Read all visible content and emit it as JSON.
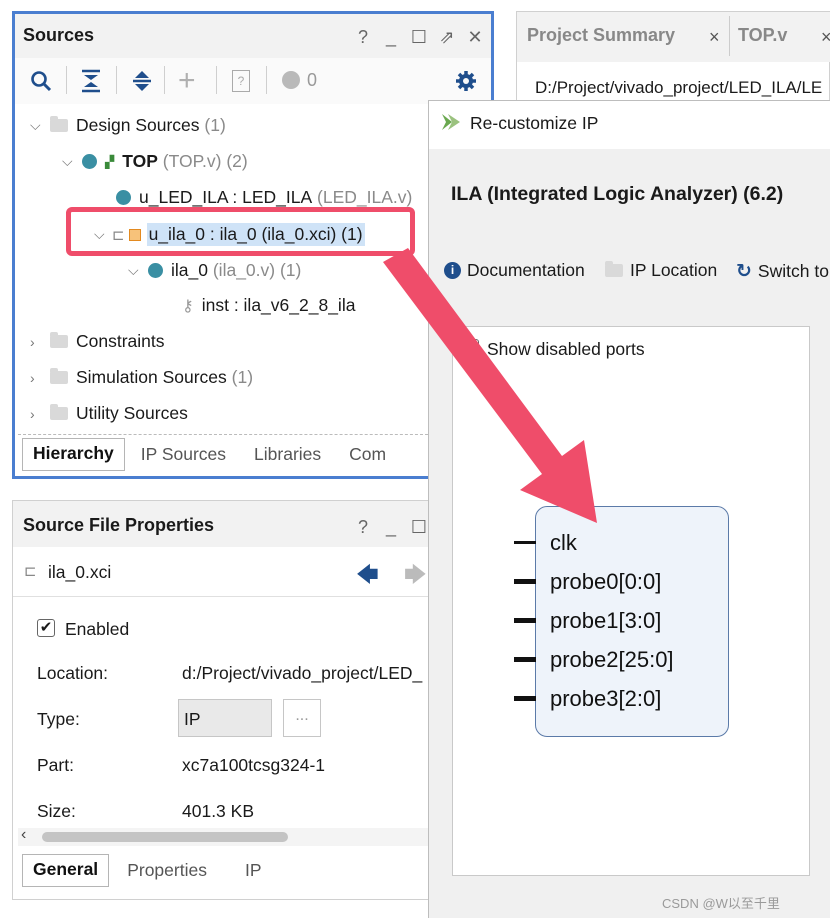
{
  "sources_panel": {
    "title": "Sources",
    "win_controls": [
      "?",
      "_",
      "☐",
      "⇗",
      "✕"
    ],
    "toolbar": {
      "counter": "0"
    },
    "tree": [
      {
        "label": "Design Sources",
        "suffix": "(1)"
      },
      {
        "label": "TOP",
        "suffix": "(TOP.v) (2)"
      },
      {
        "label": "u_LED_ILA : LED_ILA",
        "suffix": "(LED_ILA.v)"
      },
      {
        "label": "u_ila_0 : ila_0 (ila_0.xci) (1)",
        "suffix": ""
      },
      {
        "label": "ila_0",
        "suffix": "(ila_0.v) (1)"
      },
      {
        "label": "inst : ila_v6_2_8_ila",
        "suffix": ""
      },
      {
        "label": "Constraints",
        "suffix": ""
      },
      {
        "label": "Simulation Sources",
        "suffix": "(1)"
      },
      {
        "label": "Utility Sources",
        "suffix": ""
      }
    ],
    "tabs": [
      "Hierarchy",
      "IP Sources",
      "Libraries",
      "Com"
    ]
  },
  "project_summary": {
    "tabs": [
      "Project Summary",
      "TOP.v"
    ],
    "path": "D:/Project/vivado_project/LED_ILA/LE"
  },
  "source_file_properties": {
    "title": "Source File Properties",
    "win_controls": [
      "?",
      "_",
      "☐"
    ],
    "file_name": "ila_0.xci",
    "enabled_label": "Enabled",
    "rows": [
      {
        "label": "Location:",
        "value": "d:/Project/vivado_project/LED_"
      },
      {
        "label": "Type:",
        "value": "IP"
      },
      {
        "label": "Part:",
        "value": "xc7a100tcsg324-1"
      },
      {
        "label": "Size:",
        "value": "401.3 KB"
      }
    ],
    "type_button": "...",
    "tabs": [
      "General",
      "Properties",
      "IP"
    ]
  },
  "recustomize": {
    "window_title": "Re-customize IP",
    "heading": "ILA (Integrated Logic Analyzer) (6.2)",
    "links": [
      "Documentation",
      "IP Location",
      "Switch to"
    ],
    "show_disabled_label": "Show disabled ports",
    "ports": [
      "clk",
      "probe0[0:0]",
      "probe1[3:0]",
      "probe2[25:0]",
      "probe3[2:0]"
    ]
  },
  "watermark": "CSDN @W以至千里",
  "colors": {
    "highlight": "#ef4d6a",
    "select": "#cfe3f7",
    "border_blue": "#4a7ed0",
    "ip_box": "#eef3fa"
  }
}
